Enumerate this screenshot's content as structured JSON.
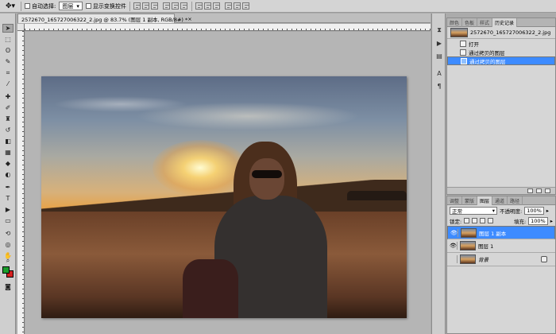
{
  "options_bar": {
    "tool_icon": "move-tool",
    "auto_select_label": "自动选择:",
    "auto_select_value": "图层",
    "show_transform_label": "显示变换控件"
  },
  "document": {
    "tab_title": "2572670_165727006322_2.jpg @ 83.7% (图层 1 副本, RGB/8#) *",
    "close_glyph": "×"
  },
  "toolbox": {
    "foreground_color": "#1a9d2c",
    "background_color": "#d42020"
  },
  "history_panel": {
    "tabs": [
      "颜色",
      "色板",
      "样式",
      "历史记录"
    ],
    "active_tab": "历史记录",
    "snapshot_label": "2572670_165727006322_2.jpg",
    "states": [
      "打开",
      "通过拷贝的图层",
      "通过拷贝的图层"
    ],
    "selected_state_index": 2
  },
  "layers_panel": {
    "tabs": [
      "调整",
      "蒙版",
      "图层",
      "通道",
      "路径"
    ],
    "active_tab": "图层",
    "blend_mode": "正常",
    "opacity_label": "不透明度:",
    "opacity_value": "100%",
    "lock_label": "锁定:",
    "fill_label": "填充:",
    "fill_value": "100%",
    "layers": [
      {
        "name": "图层 1 副本",
        "visible": true,
        "selected": true
      },
      {
        "name": "图层 1",
        "visible": true,
        "selected": false
      },
      {
        "name": "背景",
        "visible": false,
        "selected": false,
        "locked": true
      }
    ]
  },
  "accent_color": "#3d8bff"
}
